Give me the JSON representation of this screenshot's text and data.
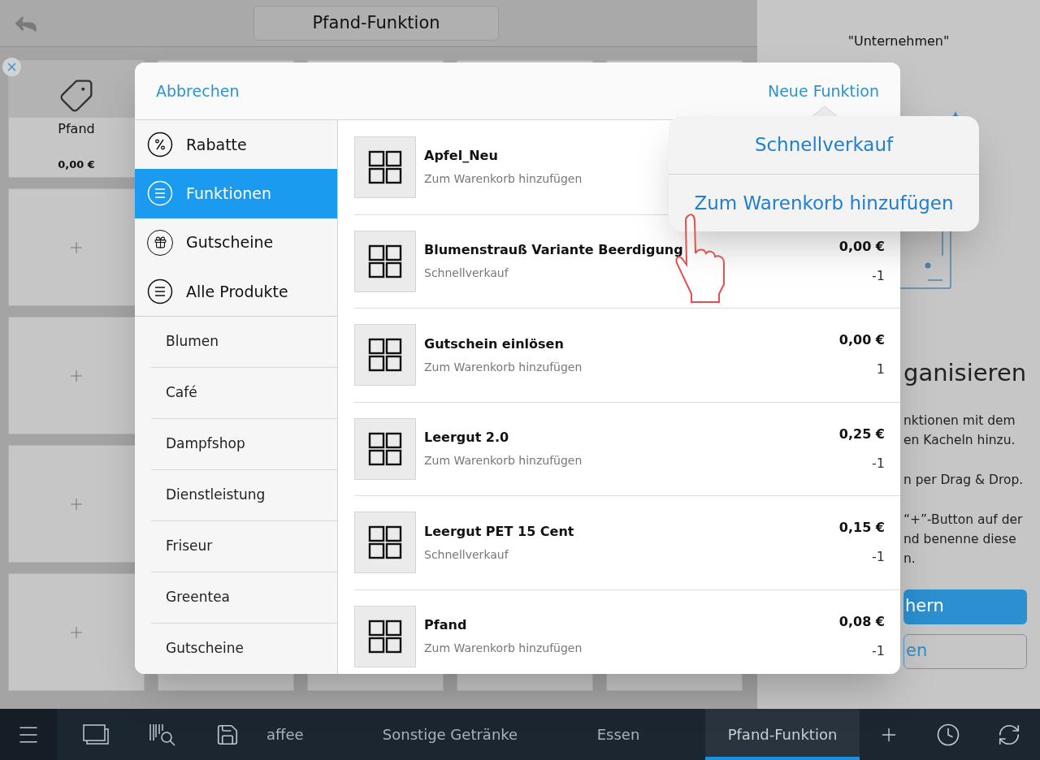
{
  "top_bar": {
    "title": "Pfand-Funktion"
  },
  "tiles": [
    {
      "kind": "product",
      "label": "Pfand",
      "price": "0,00 €"
    },
    {
      "kind": "add"
    },
    {
      "kind": "add"
    },
    {
      "kind": "add"
    },
    {
      "kind": "add"
    }
  ],
  "right_panel": {
    "company": "\"Unternehmen\"",
    "heading": "ganisieren",
    "paragraphs": [
      [
        "nktionen mit dem",
        "en Kacheln hinzu."
      ],
      [
        "n per Drag & Drop."
      ],
      [
        "“+”-Button auf der",
        "nd benenne diese",
        "n."
      ]
    ],
    "buttons": [
      {
        "kind": "primary",
        "label": "hern"
      },
      {
        "kind": "secondary",
        "label": "en"
      }
    ]
  },
  "dialog": {
    "cancel": "Abbrechen",
    "action": "Neue Funktion",
    "categories": [
      {
        "kind": "percent",
        "label": "Rabatte",
        "selected": false
      },
      {
        "kind": "list",
        "label": "Funktionen",
        "selected": true
      },
      {
        "kind": "gift",
        "label": "Gutscheine",
        "selected": false
      },
      {
        "kind": "list",
        "label": "Alle Produkte",
        "selected": false
      }
    ],
    "groups": [
      {
        "label": "Blumen",
        "selected": false
      },
      {
        "label": "Café",
        "selected": false
      },
      {
        "label": "Dampfshop",
        "selected": false
      },
      {
        "label": "Dienstleistung",
        "selected": false
      },
      {
        "label": "Friseur",
        "selected": false
      },
      {
        "label": "Greentea",
        "selected": false
      },
      {
        "label": "Gutscheine",
        "selected": false
      }
    ],
    "items": [
      {
        "title": "Apfel_Neu",
        "subtitle": "Zum Warenkorb hinzufügen"
      },
      {
        "title": "Blumenstrauß Variante Beerdigung",
        "subtitle": "Schnellverkauf",
        "price": "0,00 €",
        "quantity": "-1"
      },
      {
        "title": "Gutschein einlösen",
        "subtitle": "Zum Warenkorb hinzufügen",
        "price": "0,00 €",
        "quantity": "1"
      },
      {
        "title": "Leergut 2.0",
        "subtitle": "Zum Warenkorb hinzufügen",
        "price": "0,25 €",
        "quantity": "-1"
      },
      {
        "title": "Leergut PET 15 Cent",
        "subtitle": "Schnellverkauf",
        "price": "0,15 €",
        "quantity": "-1"
      },
      {
        "title": "Pfand",
        "subtitle": "Zum Warenkorb hinzufügen",
        "price": "0,08 €",
        "quantity": "-1"
      }
    ]
  },
  "popover": {
    "options": [
      "Schnellverkauf",
      "Zum Warenkorb hinzufügen"
    ]
  },
  "bottom_bar": {
    "tabs": [
      {
        "label": "affee",
        "selected": false
      },
      {
        "label": "Sonstige Getränke",
        "selected": false
      },
      {
        "label": "Essen",
        "selected": false
      },
      {
        "label": "Pfand-Funktion",
        "selected": true
      }
    ]
  }
}
